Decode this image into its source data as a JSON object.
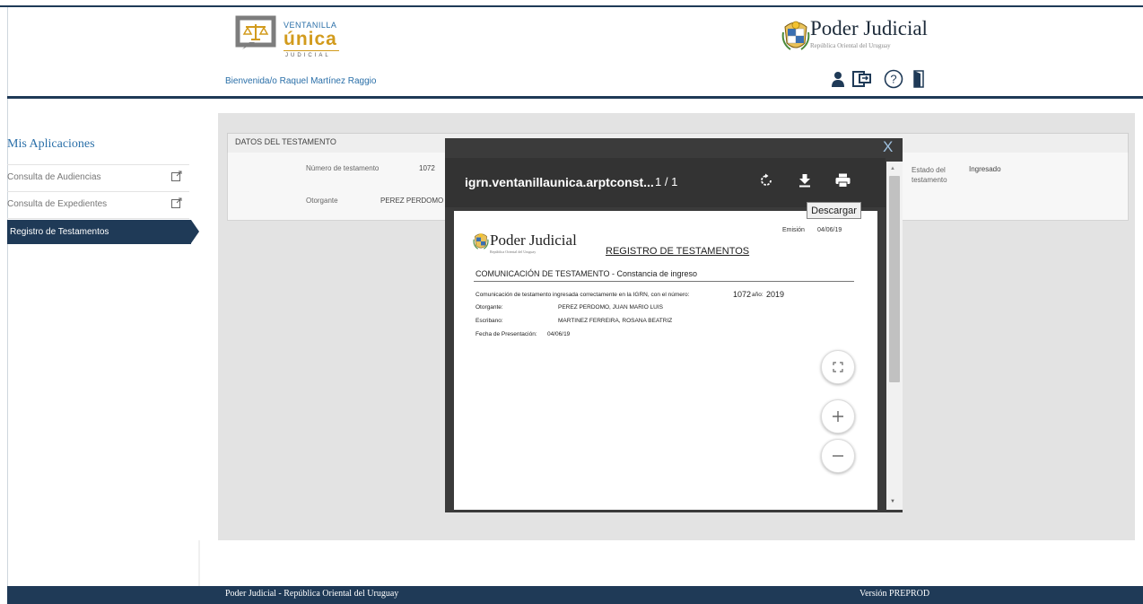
{
  "header": {
    "logo_small": "VENTANILLA",
    "logo_big": "única",
    "logo_tiny": "JUDICIAL",
    "welcome": "Bienvenida/o Raquel Martínez Raggio",
    "pj_title": "Poder Judicial",
    "pj_subtitle": "República Oriental del Uruguay",
    "icons": [
      "user-icon",
      "switch-app-icon",
      "help-icon",
      "logout-icon"
    ]
  },
  "sidebar": {
    "title": "Mis Aplicaciones",
    "items": [
      {
        "label": "Consulta de Audiencias",
        "icon": "external-link-icon"
      },
      {
        "label": "Consulta de Expedientes",
        "icon": "external-link-icon"
      },
      {
        "label": "Registro de Testamentos",
        "active": true
      }
    ]
  },
  "panel": {
    "heading": "DATOS DEL TESTAMENTO",
    "numero_label": "Número de testamento",
    "numero_value": "1072",
    "otorgante_label": "Otorgante",
    "otorgante_value": "PEREZ PERDOMO",
    "estado_label": "Estado del testamento",
    "estado_value": "Ingresado"
  },
  "viewer": {
    "close": "X",
    "title": "igrn.ventanillaunica.arptconst...",
    "pages": "1 / 1",
    "icons": [
      "rotate-icon",
      "download-icon",
      "print-icon"
    ],
    "tooltip": "Descargar",
    "fab_icons": [
      "fit-screen-icon",
      "zoom-in-icon",
      "zoom-out-icon"
    ]
  },
  "document": {
    "pj_title": "Poder Judicial",
    "pj_subtitle": "República Oriental del Uruguay",
    "heading": "REGISTRO DE TESTAMENTOS",
    "emision_label": "Emisión",
    "emision_value": "04/06/19",
    "section": "COMUNICACIÓN DE TESTAMENTO  -  Constancia de ingreso",
    "intro": "Comunicación de testamento ingresada correctamente en la IGRN, con el número:",
    "numero": "1072",
    "anio_label": "año:",
    "anio": "2019",
    "otorgante_label": "Otorgante:",
    "otorgante_value": "PEREZ PERDOMO, JUAN MARIO LUIS",
    "escribano_label": "Escribano:",
    "escribano_value": "MARTINEZ FERREIRA, ROSANA BEATRIZ",
    "fecha_label": "Fecha de Presentación:",
    "fecha_value": "04/06/19"
  },
  "footer": {
    "left": "Poder Judicial - República Oriental del Uruguay",
    "right": "Versión PREPROD"
  },
  "colors": {
    "navy": "#1f3a57",
    "gold": "#d29b1d",
    "link_blue": "#2a6fa8"
  }
}
